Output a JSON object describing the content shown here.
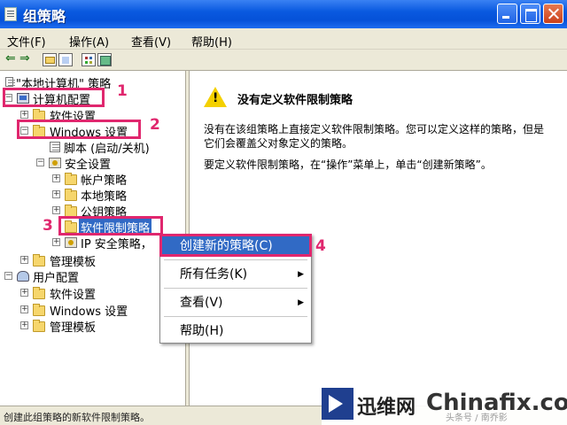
{
  "window": {
    "title": "组策略"
  },
  "menubar": {
    "file": "文件(F)",
    "action": "操作(A)",
    "view": "查看(V)",
    "help": "帮助(H)"
  },
  "toolbar": {
    "icons": [
      "back-arrow-icon",
      "forward-arrow-icon",
      "folder-up-icon",
      "show-hide-tree-icon",
      "properties-icon",
      "export-list-icon"
    ]
  },
  "tree": {
    "root": "\"本地计算机\" 策略",
    "items": [
      {
        "label": "计算机配置",
        "annotation": "1"
      },
      {
        "label": "软件设置"
      },
      {
        "label": "Windows 设置",
        "annotation": "2"
      },
      {
        "label": "脚本 (启动/关机)"
      },
      {
        "label": "安全设置"
      },
      {
        "label": "帐户策略"
      },
      {
        "label": "本地策略"
      },
      {
        "label": "公钥策略"
      },
      {
        "label": "软件限制策略",
        "annotation": "3"
      },
      {
        "label": "IP 安全策略，"
      },
      {
        "label": "管理模板"
      },
      {
        "label": "用户配置"
      },
      {
        "label": "软件设置"
      },
      {
        "label": "Windows 设置"
      },
      {
        "label": "管理模板"
      }
    ]
  },
  "content": {
    "heading": "没有定义软件限制策略",
    "para1": "没有在该组策略上直接定义软件限制策略。您可以定义这样的策略，但是它们会覆盖父对象定义的策略。",
    "para2": "要定义软件限制策略，在“操作”菜单上，单击“创建新策略”。"
  },
  "context_menu": {
    "items": [
      {
        "label": "创建新的策略(C)",
        "annotation": "4"
      },
      {
        "label": "所有任务(K)",
        "submenu": true
      },
      {
        "label": "查看(V)",
        "submenu": true
      },
      {
        "label": "帮助(H)"
      }
    ]
  },
  "statusbar": {
    "text": "创建此组策略的新软件限制策略。"
  },
  "watermark": {
    "cn": "迅维网",
    "en": "Chinafix.com",
    "sub": "头条号 / 南乔影"
  },
  "colors": {
    "highlight": "#e0276e",
    "selection": "#316ac5",
    "titlebar": "#0a5ae0"
  }
}
